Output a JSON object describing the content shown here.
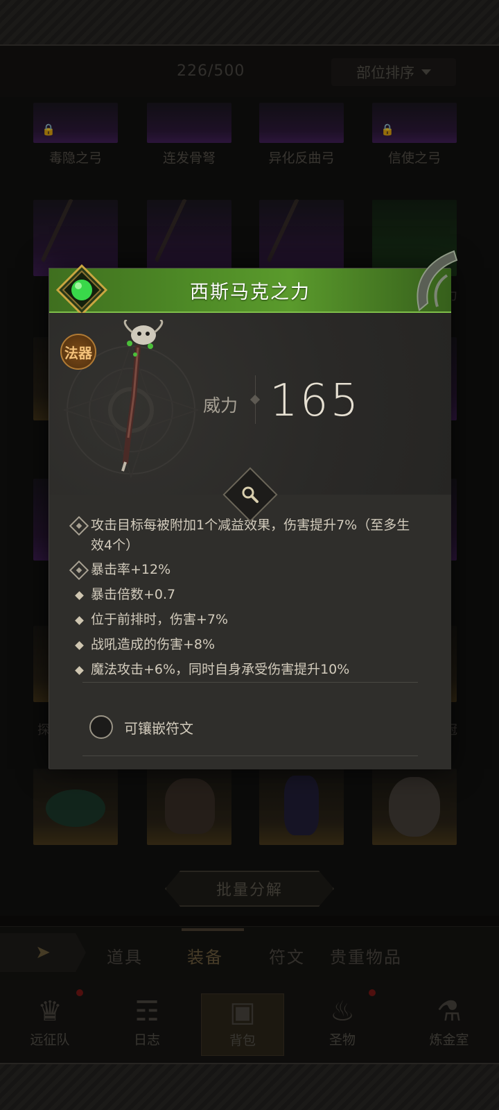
{
  "inventory": {
    "count": "226/500",
    "sort_label": "部位排序",
    "row1_labels": [
      "毒隐之弓",
      "连发骨弩",
      "异化反曲弓",
      "信使之弓"
    ],
    "side_snippets": {
      "right_row2": "力",
      "left_row4": "探",
      "right_row4": "冠"
    }
  },
  "decompose_label": "批量分解",
  "tabs": [
    "道具",
    "装备",
    "符文",
    "贵重物品"
  ],
  "active_tab": "装备",
  "bottom_nav": [
    {
      "label": "远征队",
      "icon": "helmet-icon",
      "badge": true
    },
    {
      "label": "日志",
      "icon": "scroll-icon",
      "badge": false
    },
    {
      "label": "背包",
      "icon": "chest-icon",
      "badge": false,
      "active": true
    },
    {
      "label": "圣物",
      "icon": "torch-icon",
      "badge": true
    },
    {
      "label": "炼金室",
      "icon": "alchemy-icon",
      "badge": false
    }
  ],
  "item": {
    "name": "西斯马克之力",
    "type_badge": "法器",
    "stat_label": "威力",
    "stat_value": "165",
    "attributes": [
      {
        "text": "攻击目标每被附加1个减益效果，伤害提升7%（至多生效4个）",
        "locked": true
      },
      {
        "text": "暴击率+12%",
        "locked": true
      },
      {
        "text": "暴击倍数+0.7",
        "locked": false
      },
      {
        "text": "位于前排时，伤害+7%",
        "locked": false
      },
      {
        "text": "战吼造成的伤害+8%",
        "locked": false
      },
      {
        "text": "魔法攻击+6%，同时自身承受伤害提升10%",
        "locked": false
      }
    ],
    "socket_label": "可镶嵌符文"
  },
  "colors": {
    "title_bar": "#4e8a26",
    "gem": "#39d84a",
    "badge": "#f4c27a"
  }
}
